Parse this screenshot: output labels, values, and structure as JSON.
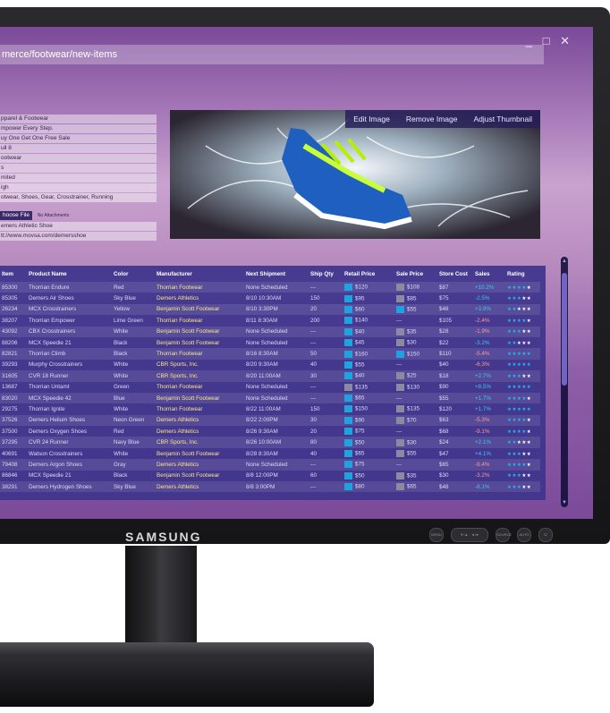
{
  "window": {
    "controls": "_ □ ✕"
  },
  "address": {
    "url": "merce/footwear/new-items"
  },
  "form": {
    "fields": [
      "pparel & Footwear",
      "mpower Every Step.",
      "uy One Get One Free Sale",
      "ull 8",
      "ootwear",
      "s",
      "mited",
      "igh",
      "otwear, Shoes, Gear, Crosstrainer, Running"
    ],
    "choose_file_label": "hoose File",
    "file_note": "No Attachments",
    "fields2": [
      "emers Athletic Shoe",
      "tt://www.movsa.com/demersshoe"
    ]
  },
  "image_toolbar": {
    "edit": "Edit Image",
    "remove": "Remove Image",
    "adjust": "Adjust Thumbnail"
  },
  "grid": {
    "headers": [
      "Item",
      "Product Name",
      "Color",
      "Manufacturer",
      "Next Shipment",
      "Ship Qty",
      "Retail Price",
      "Sale Price",
      "Store Cost",
      "Sales",
      "Rating"
    ],
    "rows": [
      {
        "item": "85300",
        "name": "Thorrian Endure",
        "color": "Red",
        "mfr": "Thorrian Footwear",
        "ship": "None Scheduled",
        "qty": "---",
        "retail": "$120",
        "rsw": "#1fa3e0",
        "sale": "$108",
        "ssw": "#8a8aa0",
        "cost": "$87",
        "sales": "+10.2%",
        "salesClass": "pos",
        "rating": "★★★★★",
        "stars": 4
      },
      {
        "item": "85305",
        "name": "Demers Air Shoes",
        "color": "Sky Blue",
        "mfr": "Demers Athletics",
        "ship": "8/10 10:30AM",
        "qty": "150",
        "retail": "$95",
        "rsw": "#1fa3e0",
        "sale": "$85",
        "ssw": "#8a8aa0",
        "cost": "$75",
        "sales": "-2.5%",
        "salesClass": "pos",
        "rating": "★★★★★",
        "stars": 3
      },
      {
        "item": "26234",
        "name": "MCX Crosstrainers",
        "color": "Yellow",
        "mfr": "Benjamin Scott Footwear",
        "ship": "8/10 3:30PM",
        "qty": "20",
        "retail": "$60",
        "rsw": "#1fa3e0",
        "sale": "$55",
        "ssw": "#1fa3e0",
        "cost": "$48",
        "sales": "+3.9%",
        "salesClass": "pos",
        "rating": "★★★★★",
        "stars": 2
      },
      {
        "item": "38207",
        "name": "Thorrian Empower",
        "color": "Lime Green",
        "mfr": "Thorrian Footwear",
        "ship": "8/11 8:30AM",
        "qty": "200",
        "retail": "$140",
        "rsw": "#1fa3e0",
        "sale": "---",
        "ssw": "",
        "cost": "$105",
        "sales": "-2.4%",
        "salesClass": "neg",
        "rating": "★★★★★",
        "stars": 4
      },
      {
        "item": "43092",
        "name": "CBX Crosstrainers",
        "color": "White",
        "mfr": "Benjamin Scott Footwear",
        "ship": "None Scheduled",
        "qty": "---",
        "retail": "$40",
        "rsw": "#1fa3e0",
        "sale": "$35",
        "ssw": "#8a8aa0",
        "cost": "$28",
        "sales": "-1.9%",
        "salesClass": "neg",
        "rating": "★★★★★",
        "stars": 3
      },
      {
        "item": "88206",
        "name": "MCX Speedie 21",
        "color": "Black",
        "mfr": "Benjamin Scott Footwear",
        "ship": "None Scheduled",
        "qty": "---",
        "retail": "$45",
        "rsw": "#1fa3e0",
        "sale": "$30",
        "ssw": "#8a8aa0",
        "cost": "$22",
        "sales": "-3.2%",
        "salesClass": "pos",
        "rating": "★★★★★",
        "stars": 2
      },
      {
        "item": "82821",
        "name": "Thorrian Climb",
        "color": "Black",
        "mfr": "Thorrian Footwear",
        "ship": "8/16 8:30AM",
        "qty": "50",
        "retail": "$160",
        "rsw": "#1fa3e0",
        "sale": "$150",
        "ssw": "#1fa3e0",
        "cost": "$110",
        "sales": "-5.4%",
        "salesClass": "neg",
        "rating": "★★★★★",
        "stars": 5
      },
      {
        "item": "39293",
        "name": "Murphy Crosstrainers",
        "color": "White",
        "mfr": "CBR Sports, Inc.",
        "ship": "8/20 9:30AM",
        "qty": "40",
        "retail": "$55",
        "rsw": "#1fa3e0",
        "sale": "---",
        "ssw": "",
        "cost": "$40",
        "sales": "-6.3%",
        "salesClass": "neg",
        "rating": "★★★★★",
        "stars": 5
      },
      {
        "item": "31605",
        "name": "CVR 18 Runner",
        "color": "White",
        "mfr": "CBR Sports, Inc.",
        "ship": "8/20 11:00AM",
        "qty": "30",
        "retail": "$40",
        "rsw": "#1fa3e0",
        "sale": "$25",
        "ssw": "#8a8aa0",
        "cost": "$18",
        "sales": "+2.7%",
        "salesClass": "pos",
        "rating": "★★★★★",
        "stars": 3
      },
      {
        "item": "13687",
        "name": "Thorrian Untamt",
        "color": "Green",
        "mfr": "Thorrian Footwear",
        "ship": "None Scheduled",
        "qty": "---",
        "retail": "$135",
        "rsw": "#8a8aa0",
        "sale": "$130",
        "ssw": "#8a8aa0",
        "cost": "$90",
        "sales": "+8.5%",
        "salesClass": "pos",
        "rating": "★★★★★",
        "stars": 5
      },
      {
        "item": "83020",
        "name": "MCX Speedie 42",
        "color": "Blue",
        "mfr": "Benjamin Scott Footwear",
        "ship": "None Scheduled",
        "qty": "---",
        "retail": "$65",
        "rsw": "#1fa3e0",
        "sale": "---",
        "ssw": "",
        "cost": "$55",
        "sales": "+1.7%",
        "salesClass": "pos",
        "rating": "★★★★★",
        "stars": 4
      },
      {
        "item": "29275",
        "name": "Thorrian Ignite",
        "color": "White",
        "mfr": "Thorrian Footwear",
        "ship": "8/22 11:00AM",
        "qty": "150",
        "retail": "$150",
        "rsw": "#1fa3e0",
        "sale": "$135",
        "ssw": "#8a8aa0",
        "cost": "$120",
        "sales": "+1.7%",
        "salesClass": "pos",
        "rating": "★★★★★",
        "stars": 5
      },
      {
        "item": "37526",
        "name": "Demers Helium Shoes",
        "color": "Neon Green",
        "mfr": "Demers Athletics",
        "ship": "8/22 2:00PM",
        "qty": "30",
        "retail": "$90",
        "rsw": "#1fa3e0",
        "sale": "$70",
        "ssw": "#8a8aa0",
        "cost": "$63",
        "sales": "-5.3%",
        "salesClass": "neg",
        "rating": "★★★★★",
        "stars": 4
      },
      {
        "item": "37500",
        "name": "Demers Oxygen Shoes",
        "color": "Red",
        "mfr": "Demers Athletics",
        "ship": "8/26 9:30AM",
        "qty": "20",
        "retail": "$75",
        "rsw": "#1fa3e0",
        "sale": "---",
        "ssw": "",
        "cost": "$68",
        "sales": "-9.1%",
        "salesClass": "neg",
        "rating": "★★★★★",
        "stars": 4
      },
      {
        "item": "37295",
        "name": "CVR 24 Runner",
        "color": "Navy Blue",
        "mfr": "CBR Sports, Inc.",
        "ship": "8/26 10:00AM",
        "qty": "80",
        "retail": "$50",
        "rsw": "#1fa3e0",
        "sale": "$30",
        "ssw": "#8a8aa0",
        "cost": "$24",
        "sales": "+2.1%",
        "salesClass": "pos",
        "rating": "★★★★★",
        "stars": 2
      },
      {
        "item": "40691",
        "name": "Watson Crosstrainers",
        "color": "White",
        "mfr": "Benjamin Scott Footwear",
        "ship": "8/28 8:30AM",
        "qty": "40",
        "retail": "$65",
        "rsw": "#1fa3e0",
        "sale": "$55",
        "ssw": "#8a8aa0",
        "cost": "$47",
        "sales": "+4.1%",
        "salesClass": "pos",
        "rating": "★★★★★",
        "stars": 3
      },
      {
        "item": "79408",
        "name": "Demers Argon Shoes",
        "color": "Gray",
        "mfr": "Demers Athletics",
        "ship": "None Scheduled",
        "qty": "---",
        "retail": "$75",
        "rsw": "#1fa3e0",
        "sale": "---",
        "ssw": "",
        "cost": "$65",
        "sales": "-9.4%",
        "salesClass": "neg",
        "rating": "★★★★★",
        "stars": 4
      },
      {
        "item": "86846",
        "name": "MCX Speedie 21",
        "color": "Black",
        "mfr": "Benjamin Scott Footwear",
        "ship": "8/8 12:00PM",
        "qty": "60",
        "retail": "$50",
        "rsw": "#1fa3e0",
        "sale": "$35",
        "ssw": "#8a8aa0",
        "cost": "$30",
        "sales": "-3.2%",
        "salesClass": "neg",
        "rating": "★★★★★",
        "stars": 3
      },
      {
        "item": "38291",
        "name": "Demers Hydrogen Shoes",
        "color": "Sky Blue",
        "mfr": "Demers Athletics",
        "ship": "8/8 3:00PM",
        "qty": "---",
        "retail": "$80",
        "rsw": "#1fa3e0",
        "sale": "$65",
        "ssw": "#8a8aa0",
        "cost": "$48",
        "sales": "-8.1%",
        "salesClass": "pos",
        "rating": "★★★★★",
        "stars": 3
      }
    ]
  },
  "monitor": {
    "brand": "SAMSUNG",
    "buttons": [
      "MENU",
      "▼/▲ · ◄/►",
      "SOURCE",
      "AUTO",
      "⏻"
    ]
  },
  "colors": {
    "grid_bg": "#3e348c",
    "accent": "#1fa3e0",
    "desktop_purple": "#8e5fa8"
  }
}
